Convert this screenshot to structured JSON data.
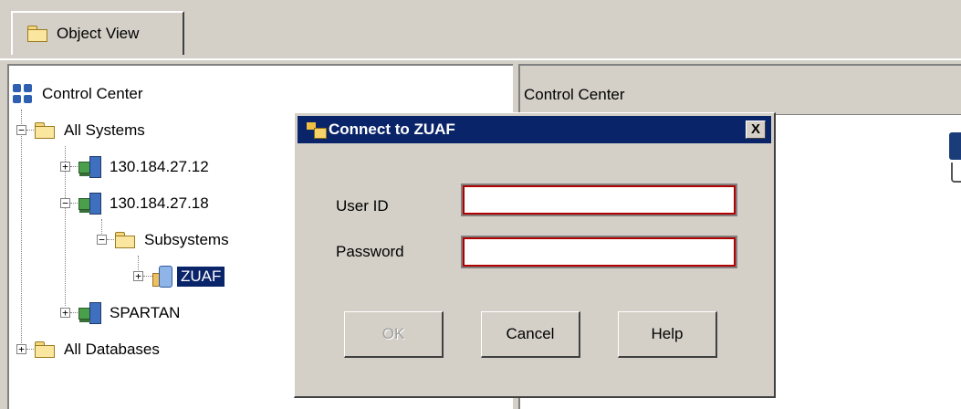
{
  "tabs": [
    {
      "label": "Object View",
      "icon": "folder-icon"
    }
  ],
  "tree": {
    "root": {
      "label": "Control Center",
      "icon": "control-center-icon"
    },
    "items": [
      {
        "label": "All Systems",
        "icon": "folder-icon",
        "expander": "−"
      },
      {
        "label": "130.184.27.12",
        "icon": "computer-icon",
        "expander": "+"
      },
      {
        "label": "130.184.27.18",
        "icon": "computer-icon",
        "expander": "−"
      },
      {
        "label": "Subsystems",
        "icon": "folder-icon",
        "expander": "−"
      },
      {
        "label": "ZUAF",
        "icon": "database-icon",
        "expander": "+",
        "selected": true
      },
      {
        "label": "SPARTAN",
        "icon": "computer-icon",
        "expander": "+"
      },
      {
        "label": "All Databases",
        "icon": "folder-icon",
        "expander": "+"
      }
    ]
  },
  "right_pane": {
    "header": "Control Center"
  },
  "dialog": {
    "title": "Connect to ZUAF",
    "close_label": "X",
    "user_id_label": "User ID",
    "user_id_value": "",
    "password_label": "Password",
    "password_value": "",
    "buttons": {
      "ok": "OK",
      "cancel": "Cancel",
      "help": "Help"
    }
  },
  "colors": {
    "selection": "#0a246a",
    "titlebar": "#0a246a",
    "chrome": "#d4d0c8",
    "field_focus_border": "#b00000"
  }
}
